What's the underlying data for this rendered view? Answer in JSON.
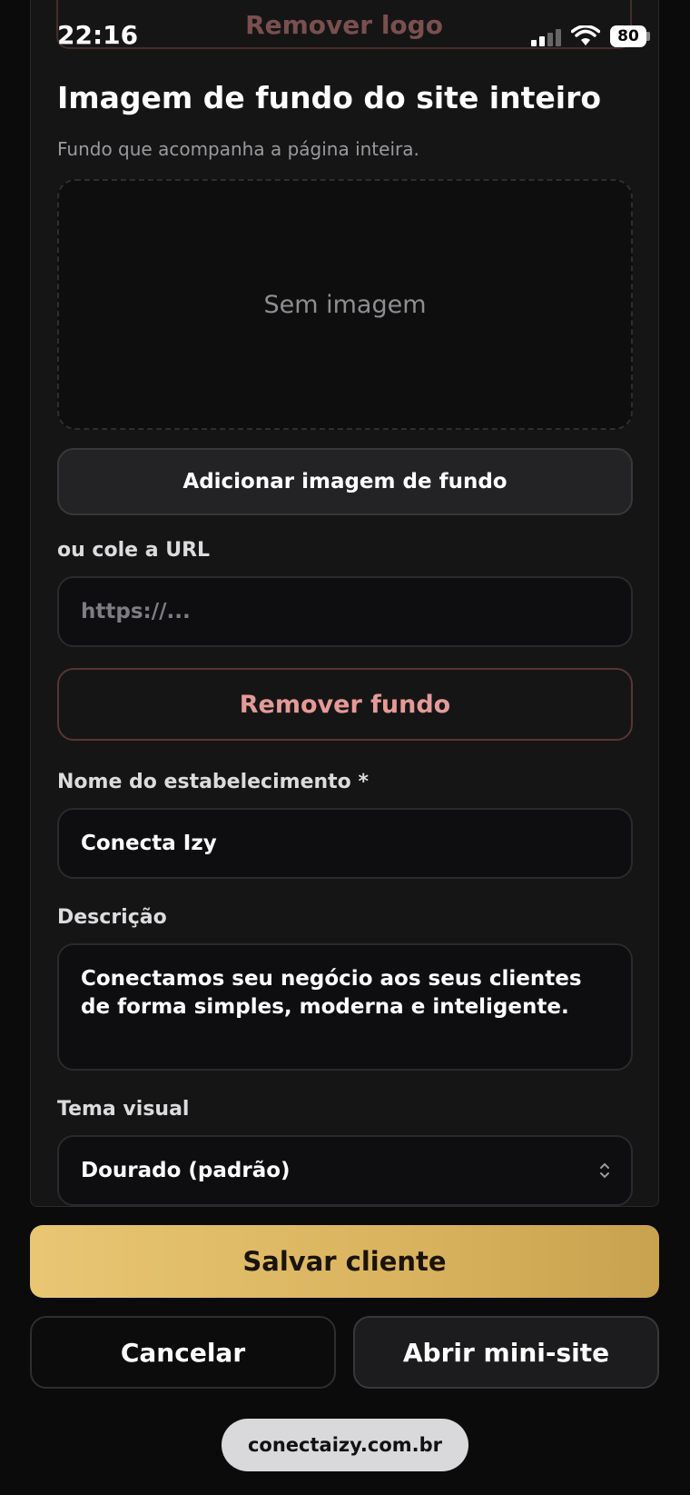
{
  "status_bar": {
    "time": "22:16",
    "battery": "80"
  },
  "top_strip": {
    "remove_logo_label": "Remover logo"
  },
  "background_section": {
    "title": "Imagem de fundo do site inteiro",
    "subtitle": "Fundo que acompanha a página inteira.",
    "empty_text": "Sem imagem",
    "add_button": "Adicionar imagem de fundo",
    "url_label": "ou cole a URL",
    "url_placeholder": "https://...",
    "remove_button": "Remover fundo"
  },
  "fields": {
    "name_label": "Nome do estabelecimento *",
    "name_value": "Conecta Izy",
    "description_label": "Descrição",
    "description_value": "Conectamos seu negócio aos seus clientes de forma simples, moderna e inteligente.",
    "theme_label": "Tema visual",
    "theme_value": "Dourado (padrão)"
  },
  "actions": {
    "save": "Salvar cliente",
    "cancel": "Cancelar",
    "open": "Abrir mini-site"
  },
  "browser": {
    "url": "conectaizy.com.br"
  },
  "colors": {
    "accent_gold": "#e3c16c",
    "danger_text": "#e59a98"
  }
}
